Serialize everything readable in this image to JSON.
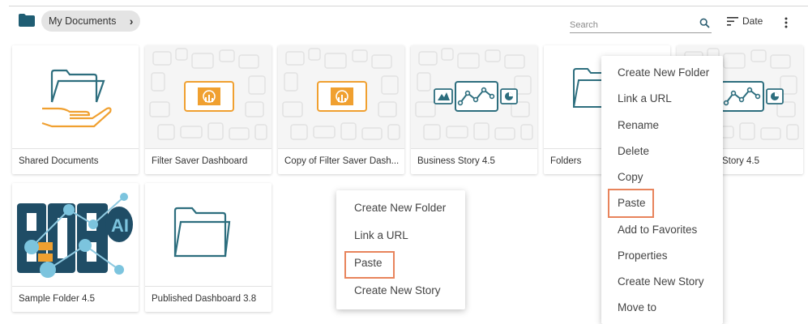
{
  "header": {
    "breadcrumb": "My Documents",
    "breadcrumb_chevron": "›",
    "search_placeholder": "Search",
    "sort_label": "Date"
  },
  "cards": [
    {
      "name": "Shared Documents",
      "icon": "shared-folder-icon"
    },
    {
      "name": "Filter Saver Dashboard",
      "icon": "dashboard-icon"
    },
    {
      "name": "Copy of Filter Saver Dash...",
      "icon": "dashboard-icon"
    },
    {
      "name": "Business Story 4.5",
      "icon": "story-icon"
    },
    {
      "name": "Folders",
      "icon": "folder-icon"
    },
    {
      "name": "Story 4.5",
      "icon": "story-icon"
    },
    {
      "name": "Sample Folder 4.5",
      "icon": "bdb-ai-logo"
    },
    {
      "name": "Published Dashboard 3.8",
      "icon": "folder-icon"
    }
  ],
  "context_menu_folder": {
    "items": [
      "Create New Folder",
      "Link a URL",
      "Rename",
      "Delete",
      "Copy",
      "Paste",
      "Add to Favorites",
      "Properties",
      "Create New Story",
      "Move to"
    ],
    "highlighted": "Paste"
  },
  "context_menu_space": {
    "items": [
      "Create New Folder",
      "Link a URL",
      "Paste",
      "Create New Story"
    ],
    "highlighted": "Paste"
  },
  "colors": {
    "accent_teal": "#2d6e7e",
    "accent_orange": "#f0a030",
    "highlight_border": "#e8845c",
    "breadcrumb_bg": "#e4e4e4"
  }
}
